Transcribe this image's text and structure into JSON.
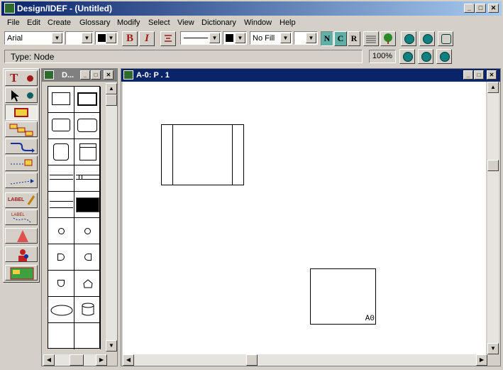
{
  "app": {
    "title": "Design/IDEF - (Untitled)"
  },
  "caption_buttons": {
    "minimize": "_",
    "maximize": "□",
    "close": "✕"
  },
  "menu": [
    "File",
    "Edit",
    "Create",
    "Glossary",
    "Modify",
    "Select",
    "View",
    "Dictionary",
    "Window",
    "Help"
  ],
  "toolbar": {
    "font": "Arial",
    "size": "",
    "bold": "B",
    "italic": "I",
    "fill": "No Fill",
    "n_btn": "N",
    "c_btn": "C",
    "r_btn": "R"
  },
  "status": {
    "type_label": "Type: Node",
    "zoom": "100%"
  },
  "tools": {
    "text_tool": "T",
    "label_tool": "LABEL"
  },
  "palette_window": {
    "title": "D..."
  },
  "diagram_window": {
    "title": "A-0:  P . 1",
    "box_label": "A0"
  },
  "colors": {
    "title_active": "#0a246a",
    "title_inactive": "#808080",
    "face": "#d4d0c8"
  }
}
